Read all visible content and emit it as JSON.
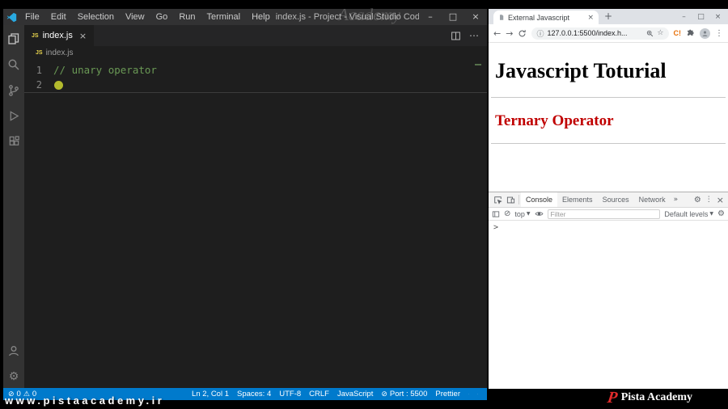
{
  "vscode": {
    "title": "index.js - Project - Visual Studio Code",
    "menus": [
      "File",
      "Edit",
      "Selection",
      "View",
      "Go",
      "Run",
      "Terminal",
      "Help"
    ],
    "tab_label": "index.js",
    "js_badge": "JS",
    "breadcrumb": "index.js",
    "editor": {
      "comment_color": "#6a9955",
      "lines": [
        {
          "num": "1",
          "code": "// unary operator"
        },
        {
          "num": "2",
          "code": ""
        }
      ]
    },
    "status": {
      "errors": "0",
      "warnings": "0",
      "cursor": "Ln 2, Col 1",
      "indent": "Spaces: 4",
      "encoding": "UTF-8",
      "eol": "CRLF",
      "language": "JavaScript",
      "port": "Port : 5500",
      "formatter": "Prettier"
    },
    "accent_color": "#007acc"
  },
  "browser": {
    "tab_title": "External Javascript",
    "url": "127.0.0.1:5500/index.h...",
    "extension_badge": "C!",
    "page": {
      "heading1": "Javascript Toturial",
      "heading2": "Ternary Operator",
      "heading2_color": "#c00000"
    },
    "devtools": {
      "tabs": [
        "Console",
        "Elements",
        "Sources",
        "Network"
      ],
      "more_tabs": "»",
      "context_selector": "top",
      "filter_placeholder": "Filter",
      "levels": "Default levels",
      "prompt": ">"
    }
  },
  "watermark": {
    "url_text": "www.pistaacademy.ir",
    "brand": "Pista Academy",
    "logo_letter": "P",
    "ghost": "Academy"
  },
  "icons": {
    "close": "×",
    "minimize": "–",
    "maximize": "□",
    "ellipsis_h": "⋯",
    "ellipsis_v": "⋮",
    "new_tab": "+",
    "back": "←",
    "forward": "→",
    "info": "ⓘ",
    "star": "☆",
    "gear": "⚙",
    "circle_slash": "⊘",
    "warning": "⚠",
    "dropdown": "▼"
  }
}
